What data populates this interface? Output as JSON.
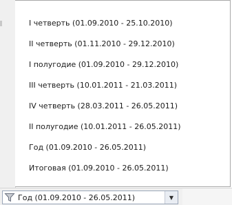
{
  "period_menu": {
    "items": [
      {
        "label": "I четверть (01.09.2010 - 25.10.2010)"
      },
      {
        "label": "II четверть (01.11.2010 - 29.12.2010)"
      },
      {
        "label": "I полугодие (01.09.2010 - 29.12.2010)"
      },
      {
        "label": "III четверть (10.01.2011 - 21.03.2011)"
      },
      {
        "label": "IV четверть (28.03.2011 - 26.05.2011)"
      },
      {
        "label": "II полугодие (10.01.2011 - 26.05.2011)"
      },
      {
        "label": "Год (01.09.2010 - 26.05.2011)"
      },
      {
        "label": "Итоговая (01.09.2010 - 26.05.2011)"
      }
    ]
  },
  "filter_combo": {
    "value": "Год (01.09.2010 - 26.05.2011)",
    "icon": "filter-icon",
    "arrow_icon": "chevron-down-icon"
  }
}
